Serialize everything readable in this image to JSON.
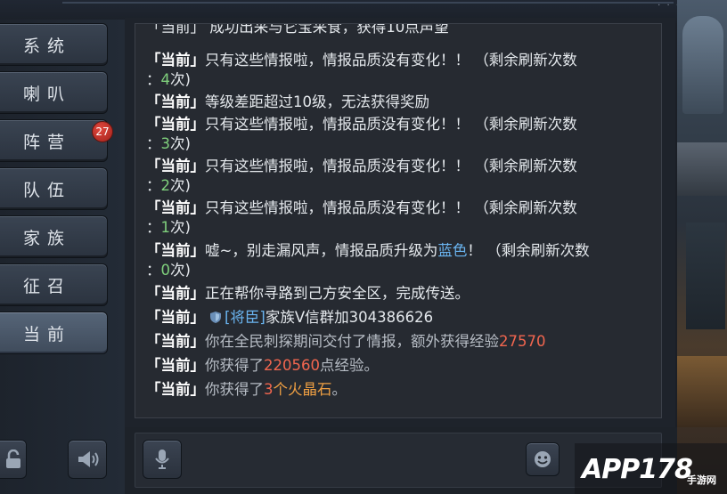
{
  "sidebar": {
    "tabs": [
      {
        "label": "系统"
      },
      {
        "label": "喇叭"
      },
      {
        "label": "阵营"
      },
      {
        "label": "队伍"
      },
      {
        "label": "家族"
      },
      {
        "label": "征召"
      },
      {
        "label": "当前"
      }
    ],
    "active_tab": "当前",
    "camp_badge": "27"
  },
  "chat": {
    "partial_top": "「当前」 成功出采与它宝采食，获得10点声望",
    "messages": [
      {
        "tag": "「当前」",
        "text": "只有这些情报啦，情报品质没有变化！！ （剩余刷新次数",
        "line2_prefix": "：",
        "count": "4",
        "line2_suffix": "次)"
      },
      {
        "tag": "「当前」",
        "text": "等级差距超过10级，无法获得奖励"
      },
      {
        "tag": "「当前」",
        "text": "只有这些情报啦，情报品质没有变化！！ （剩余刷新次数",
        "line2_prefix": "：",
        "count": "3",
        "line2_suffix": "次)"
      },
      {
        "tag": "「当前」",
        "text": "只有这些情报啦，情报品质没有变化！！ （剩余刷新次数",
        "line2_prefix": "：",
        "count": "2",
        "line2_suffix": "次)"
      },
      {
        "tag": "「当前」",
        "text": "只有这些情报啦，情报品质没有变化！！ （剩余刷新次数",
        "line2_prefix": "：",
        "count": "1",
        "line2_suffix": "次)"
      },
      {
        "tag": "「当前」",
        "text_a": "嘘~，别走漏风声，情报品质升级为",
        "highlight": "蓝色",
        "text_b": "！ （剩余刷新次数",
        "line2_prefix": "：",
        "count": "0",
        "line2_suffix": "次)"
      },
      {
        "tag": "「当前」",
        "text": "正在帮你寻路到己方安全区，完成传送。"
      },
      {
        "tag": "「当前」",
        "sender": "[将臣]",
        "text": "家族V信群加304386626"
      },
      {
        "tag": "「当前」",
        "text": "你在全民刺探期间交付了情报，额外获得经验",
        "value": "27570"
      },
      {
        "tag": "「当前」",
        "text_a": "你获得了",
        "value": "220560",
        "text_b": "点经验。"
      },
      {
        "tag": "「当前」",
        "text_a": "你获得了",
        "value": "3",
        "item": "个火晶石",
        "text_b": "。"
      }
    ]
  },
  "colors": {
    "green_count": "#7fd07c",
    "blue_highlight": "#6ab4f0",
    "red_value": "#f2664f",
    "orange_item": "#f0a043"
  },
  "icons": [
    "lock-icon",
    "speaker-icon",
    "microphone-icon",
    "emoji-icon",
    "shield-icon"
  ],
  "watermark": {
    "logo": "APP178",
    "site": "手游网"
  }
}
